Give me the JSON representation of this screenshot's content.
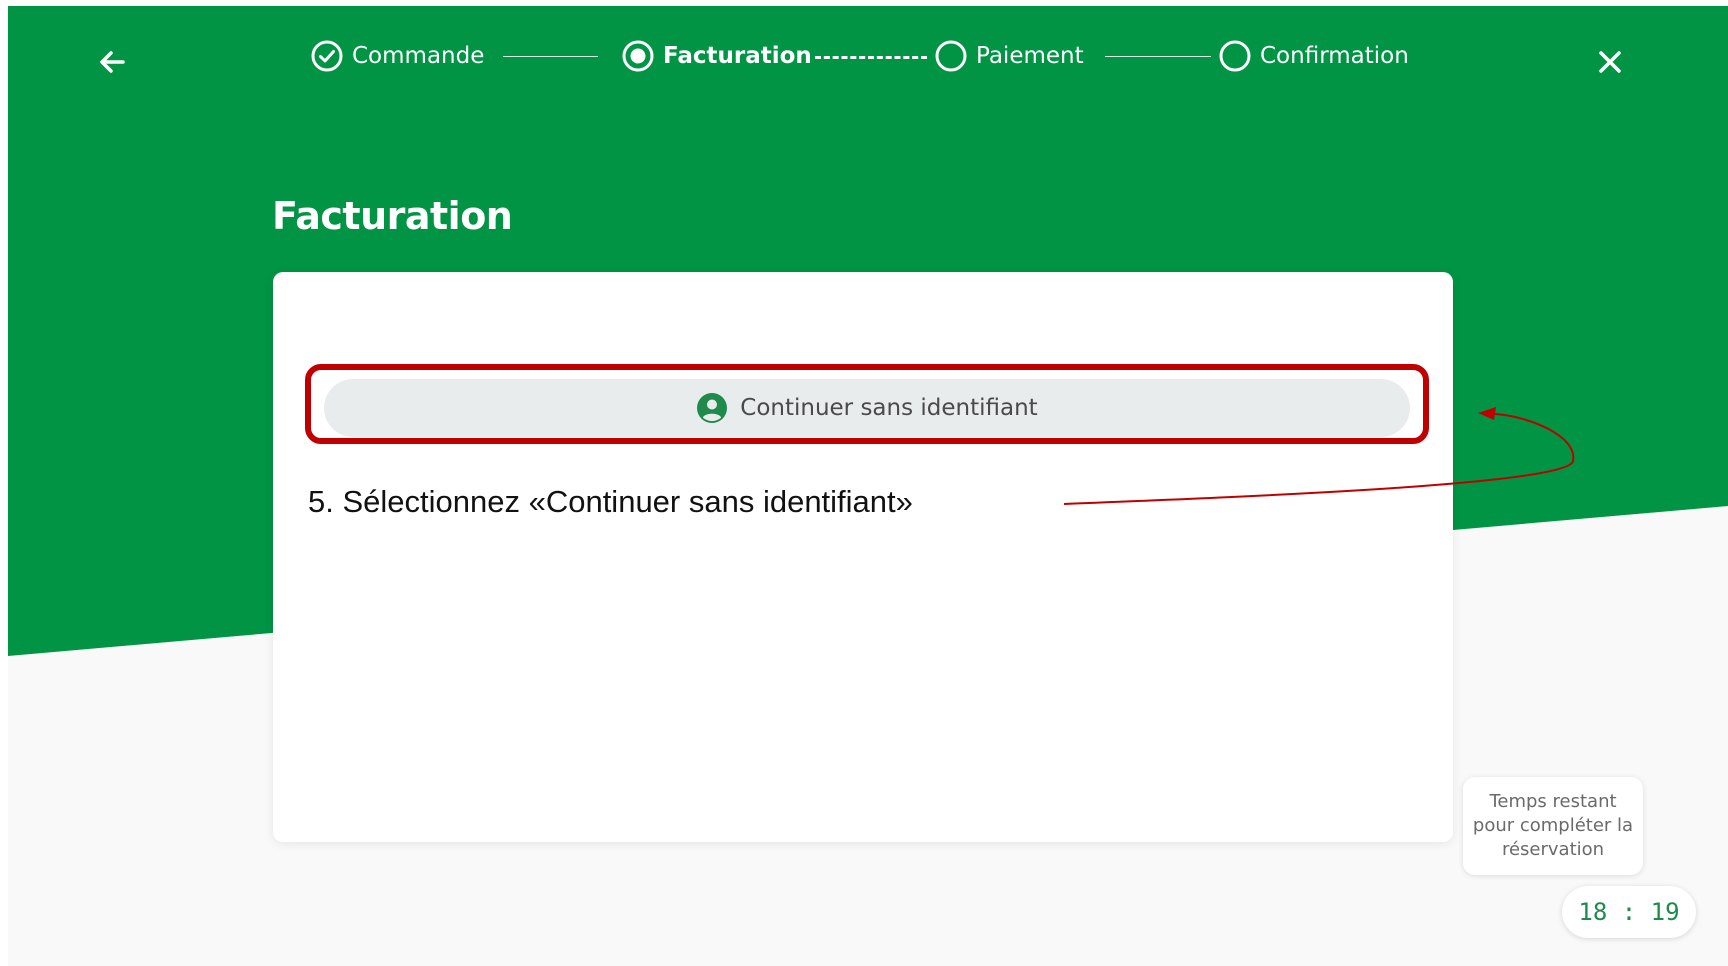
{
  "colors": {
    "brand_green": "#009444",
    "highlight_red": "#c00000",
    "timer_green": "#1f8a4c"
  },
  "topbar": {
    "back_icon": "arrow-left-icon",
    "close_icon": "close-icon",
    "steps": [
      {
        "label": "Commande",
        "state": "completed",
        "icon": "check-circle-icon"
      },
      {
        "label": "Facturation",
        "state": "current",
        "icon": "radio-selected-icon"
      },
      {
        "label": "Paiement",
        "state": "upcoming",
        "icon": "empty-circle-icon"
      },
      {
        "label": "Confirmation",
        "state": "upcoming",
        "icon": "empty-circle-icon"
      }
    ]
  },
  "main": {
    "title": "Facturation",
    "continue_button": {
      "label": "Continuer sans identifiant",
      "icon": "user-circle-icon"
    }
  },
  "annotation": {
    "text": "5. Sélectionnez «Continuer sans identifiant»"
  },
  "timer": {
    "label": "Temps restant pour compléter la réservation",
    "value": "18 : 19"
  }
}
